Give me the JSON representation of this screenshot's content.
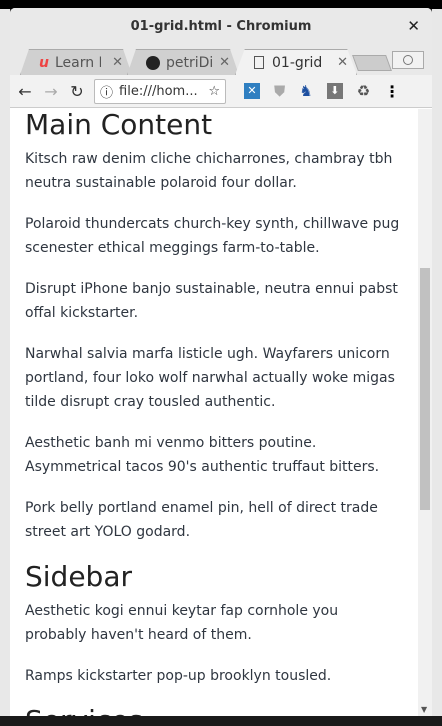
{
  "window": {
    "title": "01-grid.html - Chromium",
    "close": "✕"
  },
  "tabs": [
    {
      "label": "Learn I",
      "icon": "udemy-icon",
      "active": false
    },
    {
      "label": "petriDi",
      "icon": "github-icon",
      "active": false
    },
    {
      "label": "01-grid",
      "icon": "document-icon",
      "active": true
    }
  ],
  "toolbar": {
    "url": "file:///hom...",
    "back": "←",
    "forward": "→",
    "reload": "↻",
    "info": "ⓘ",
    "star": "☆",
    "menu": "⋮"
  },
  "content": {
    "h_main": "Main Content",
    "main_paragraphs": [
      "Kitsch raw denim cliche chicharrones, chambray tbh neutra sustainable polaroid four dollar.",
      "Polaroid thundercats church-key synth, chillwave pug scenester ethical meggings farm-to-table.",
      "Disrupt iPhone banjo sustainable, neutra ennui pabst offal kickstarter.",
      "Narwhal salvia marfa listicle ugh. Wayfarers unicorn portland, four loko wolf narwhal actually woke migas tilde disrupt cray tousled authentic.",
      "Aesthetic banh mi venmo bitters poutine. Asymmetrical tacos 90's authentic truffaut bitters.",
      "Pork belly portland enamel pin, hell of direct trade street art YOLO godard."
    ],
    "h_sidebar": "Sidebar",
    "sidebar_paragraphs": [
      "Aesthetic kogi ennui keytar fap cornhole you probably haven't heard of them.",
      "Ramps kickstarter pop-up brooklyn tousled."
    ],
    "h_next": "Services"
  }
}
